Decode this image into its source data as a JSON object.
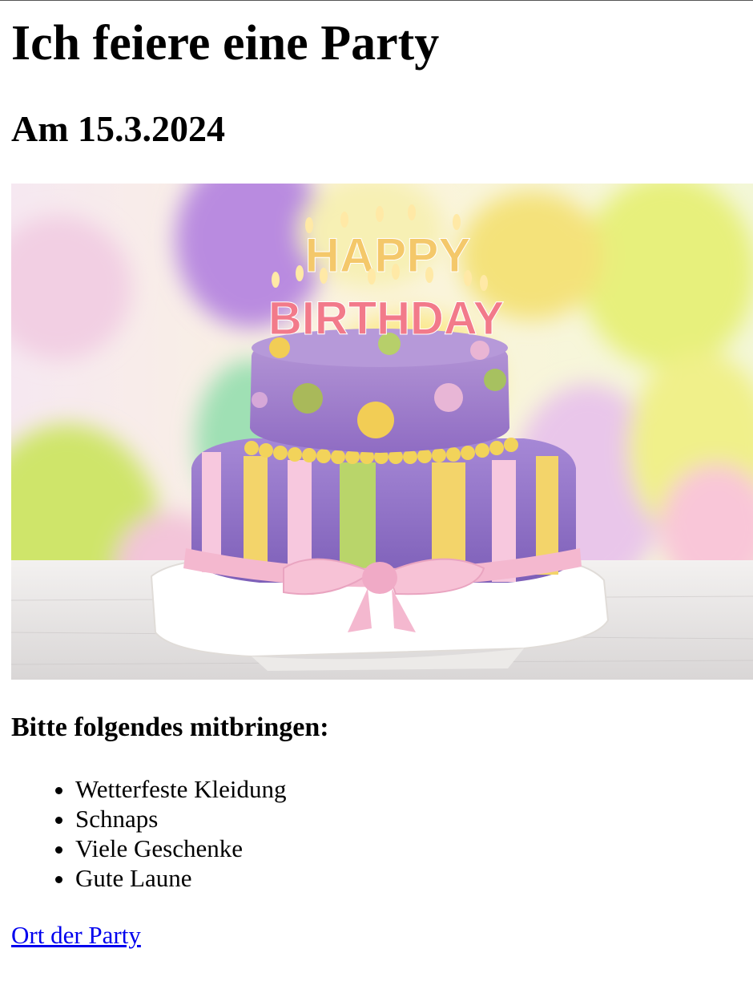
{
  "page": {
    "title": "Ich feiere eine Party",
    "date_heading": "Am 15.3.2024",
    "bring_heading": "Bitte folgendes mitbringen:",
    "bring_items": [
      "Wetterfeste Kleidung",
      "Schnaps",
      "Viele Geschenke",
      "Gute Laune"
    ],
    "location_link": "Ort der Party",
    "link_color": "#0000ee"
  },
  "image": {
    "topper_line1": "HAPPY",
    "topper_line2": "BIRTHDAY",
    "icon": "birthday-cake-photo"
  }
}
